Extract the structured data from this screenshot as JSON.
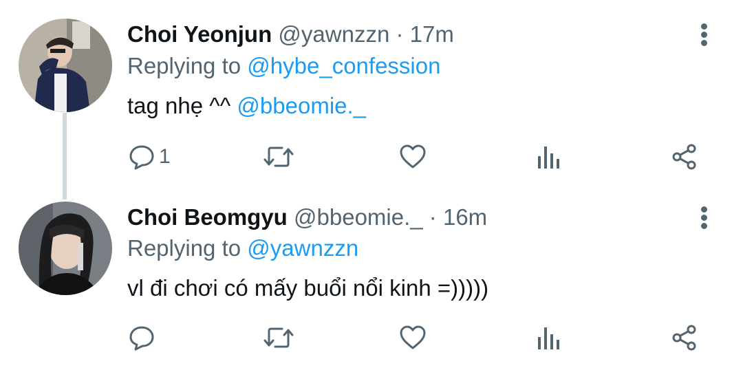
{
  "tweets": [
    {
      "name": "Choi Yeonjun",
      "handle": "@yawnzzn",
      "separator": "·",
      "time": "17m",
      "replying_prefix": "Replying to",
      "replying_to": "@hybe_confession",
      "text_before": "tag nhẹ ^^ ",
      "text_mention": "@bbeomie._",
      "reply_count": "1",
      "avatar_icon": "avatar-photo"
    },
    {
      "name": "Choi Beomgyu",
      "handle": "@bbeomie._",
      "separator": "·",
      "time": "16m",
      "replying_prefix": "Replying to",
      "replying_to": "@yawnzzn",
      "text": "vl đi chơi có mấy buổi nổi kinh =)))))",
      "avatar_icon": "avatar-photo"
    }
  ],
  "icons": {
    "reply": "speech-bubble-icon",
    "retweet": "retweet-icon",
    "like": "heart-icon",
    "analytics": "bar-chart-icon",
    "share": "share-icon",
    "more": "vertical-dots-icon"
  },
  "colors": {
    "text": "#0f1419",
    "secondary": "#536471",
    "link": "#1d9bf0",
    "thread_line": "#cfd9de"
  }
}
